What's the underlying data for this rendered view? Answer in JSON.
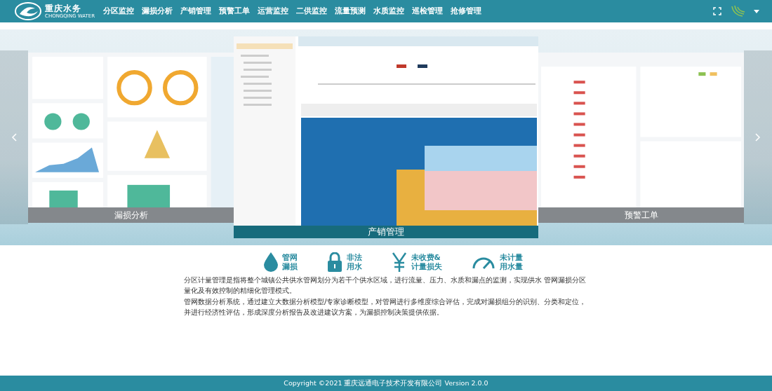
{
  "header": {
    "logo": {
      "title": "重庆水务",
      "subtitle": "CHONGQING WATER"
    },
    "nav": [
      "分区监控",
      "漏损分析",
      "产销管理",
      "预警工单",
      "运营监控",
      "二供监控",
      "流量预测",
      "水质监控",
      "巡检管理",
      "抢修管理"
    ]
  },
  "carousel": {
    "slides": [
      {
        "kind": "dashboard",
        "caption": "漏损分析",
        "selected": false
      },
      {
        "kind": "table",
        "caption": "产销管理",
        "selected": true
      },
      {
        "kind": "list",
        "caption": "预警工单",
        "selected": false
      }
    ]
  },
  "features": [
    {
      "kind": "drop",
      "lines": [
        "管网",
        "漏损"
      ]
    },
    {
      "kind": "lock",
      "lines": [
        "非法",
        "用水"
      ]
    },
    {
      "kind": "yen",
      "lines": [
        "未收费&",
        "计量损失"
      ]
    },
    {
      "kind": "gauge",
      "lines": [
        "未计量",
        "用水量"
      ]
    }
  ],
  "description": [
    "分区计量管理是指将整个城镇公共供水管网划分为若干个供水区域，进行流量、压力、水质和漏点的监测，实现供水 管网漏损分区量化及有效控制的精细化管理模式。",
    "管网数据分析系统，通过建立大数据分析模型/专家诊断模型，对管网进行多维度综合评估，完成对漏损组分的识别、分类和定位，并进行经济性评估，形成深度分析报告及改进建议方案，为漏损控制决策提供依据。"
  ],
  "footer": "Copyright ©2021 重庆远通电子技术开发有限公司 Version 2.0.0"
}
